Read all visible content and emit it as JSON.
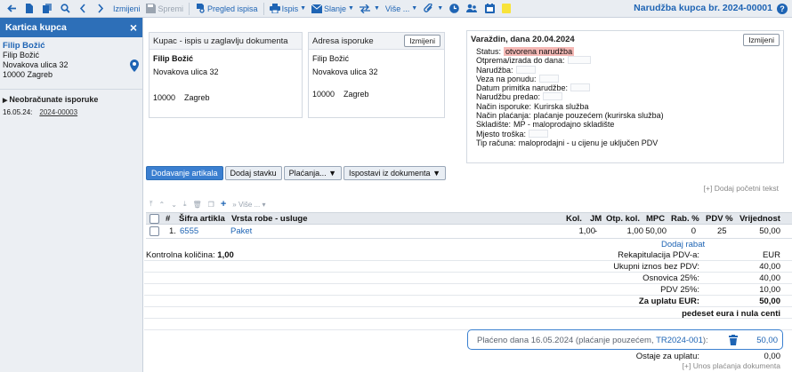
{
  "toolbar": {
    "izmijeni": "Izmijeni",
    "spremi": "Spremi",
    "pregled": "Pregled ispisa",
    "ispis": "Ispis",
    "slanje": "Slanje",
    "vise": "Više ...",
    "document_title": "Narudžba kupca br. 2024-00001",
    "help": "?"
  },
  "sidebar": {
    "title": "Kartica kupca",
    "close": "×",
    "customer_name": "Filip Božić",
    "customer_line2": "Filip Božić",
    "address": "Novakova ulica 32",
    "city": "10000 Zagreb",
    "unbilled_title": "Neobračunate isporuke",
    "unbilled_date": "16.05.24:",
    "unbilled_link": "2024-00003"
  },
  "header_panel": {
    "title": "Kupac - ispis u zaglavlju dokumenta",
    "name": "Filip Božić",
    "address": "Novakova ulica 32",
    "zip": "10000",
    "city": "Zagreb"
  },
  "delivery_panel": {
    "title": "Adresa isporuke",
    "button": "Izmijeni",
    "name": "Filip Božić",
    "address": "Novakova ulica 32",
    "zip": "10000",
    "city": "Zagreb"
  },
  "info_panel": {
    "title": "Varaždin, dana 20.04.2024",
    "button": "Izmijeni",
    "rows": [
      {
        "label": "Status:",
        "value": "otvorena narudžba"
      },
      {
        "label": "Otprema/izrada do dana:",
        "value": ""
      },
      {
        "label": "Narudžba:",
        "value": ""
      },
      {
        "label": "Veza na ponudu:",
        "value": ""
      },
      {
        "label": "Datum primitka narudžbe:",
        "value": ""
      },
      {
        "label": "Narudžbu predao:",
        "value": ""
      },
      {
        "label": "Način isporuke:",
        "value": "Kurirska služba"
      },
      {
        "label": "Način plaćanja:",
        "value": "plaćanje pouzećem (kurirska služba)"
      },
      {
        "label": "Skladište:",
        "value": "MP - maloprodajno skladište"
      },
      {
        "label": "Mjesto troška:",
        "value": ""
      },
      {
        "label": "Tip računa:",
        "value": "maloprodajni - u cijenu je uključen PDV"
      }
    ]
  },
  "tabs": [
    "Dodavanje artikala",
    "Dodaj stavku",
    "Plaćanja... ▼",
    "Ispostavi iz dokumenta ▼"
  ],
  "add_start_text": "[+] Dodaj početni tekst",
  "mini_toolbar": {
    "more": "» Više ..."
  },
  "table": {
    "headers": {
      "num": "#",
      "code": "Šifra artikla",
      "type": "Vrsta robe - usluge",
      "qty": "Kol.",
      "unit": "JM",
      "open_qty": "Otp. kol.",
      "mpc": "MPC",
      "discount": "Rab. %",
      "vat": "PDV %",
      "value": "Vrijednost"
    },
    "rows": [
      {
        "num": "1.",
        "code": "6555",
        "type": "Paket",
        "qty": "1,00",
        "unit": "-",
        "open_qty": "1,00",
        "mpc": "50,00",
        "discount": "0",
        "vat": "25",
        "value": "50,00"
      }
    ],
    "add_discount": "Dodaj rabat"
  },
  "summary": {
    "control_label": "Kontrolna količina:",
    "control_value": "1,00",
    "rows": [
      {
        "label": "Rekapitulacija PDV-a:",
        "value": "EUR"
      },
      {
        "label": "Ukupni iznos bez PDV:",
        "value": "40,00"
      },
      {
        "label": "Osnovica 25%:",
        "value": "40,00"
      },
      {
        "label": "PDV 25%:",
        "value": "10,00"
      },
      {
        "label": "Za uplatu EUR:",
        "value": "50,00"
      }
    ],
    "in_words": "pedeset eura i nula centi",
    "payment_text": "Plaćeno dana 16.05.2024 (plaćanje pouzećem, ",
    "payment_link": "TR2024-001",
    "payment_close": "):",
    "payment_value": "50,00",
    "remaining_label": "Ostaje za uplatu:",
    "remaining_value": "0,00",
    "add_payment": "[+] Unos plaćanja dokumenta"
  }
}
